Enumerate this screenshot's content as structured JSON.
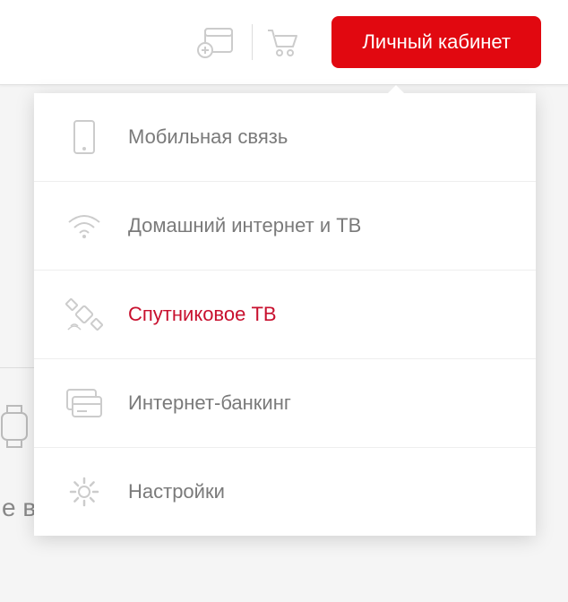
{
  "header": {
    "account_button": "Личный кабинет"
  },
  "menu": {
    "items": [
      {
        "label": "Мобильная связь",
        "icon": "phone-icon",
        "active": false
      },
      {
        "label": "Домашний интернет и ТВ",
        "icon": "wifi-icon",
        "active": false
      },
      {
        "label": "Спутниковое ТВ",
        "icon": "satellite-icon",
        "active": true
      },
      {
        "label": "Интернет-банкинг",
        "icon": "card-icon",
        "active": false
      },
      {
        "label": "Настройки",
        "icon": "gear-icon",
        "active": false
      }
    ]
  },
  "background": {
    "partial_text": "е в"
  },
  "colors": {
    "accent": "#e10810",
    "active_text": "#c8102e",
    "muted_text": "#7a7a7a",
    "icon_stroke": "#cccccc"
  }
}
